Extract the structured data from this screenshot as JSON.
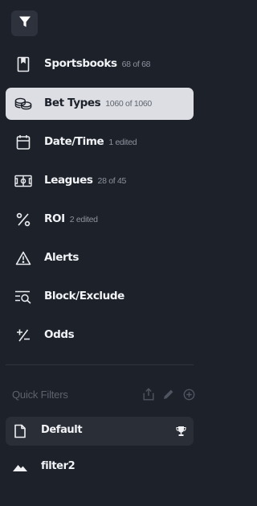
{
  "filter_button": {
    "icon": "filter-icon"
  },
  "nav": {
    "items": [
      {
        "label": "Sportsbooks",
        "count": "68 of 68",
        "icon": "book-icon",
        "selected": false
      },
      {
        "label": "Bet Types",
        "count": "1060 of 1060",
        "icon": "chips-icon",
        "selected": true
      },
      {
        "label": "Date/Time",
        "count": "1 edited",
        "icon": "calendar-icon",
        "selected": false
      },
      {
        "label": "Leagues",
        "count": "28 of 45",
        "icon": "field-icon",
        "selected": false
      },
      {
        "label": "ROI",
        "count": "2 edited",
        "icon": "percent-icon",
        "selected": false
      },
      {
        "label": "Alerts",
        "count": "",
        "icon": "warning-icon",
        "selected": false
      },
      {
        "label": "Block/Exclude",
        "count": "",
        "icon": "search-list-icon",
        "selected": false
      },
      {
        "label": "Odds",
        "count": "",
        "icon": "plus-minus-icon",
        "selected": false
      }
    ]
  },
  "quick_filters": {
    "title": "Quick Filters",
    "actions": [
      "share-icon",
      "edit-icon",
      "add-circle-icon"
    ],
    "items": [
      {
        "label": "Default",
        "icon": "document-icon",
        "active": true,
        "badge_icon": "trophy-icon"
      },
      {
        "label": "filter2",
        "icon": "mountain-icon",
        "active": false
      }
    ]
  },
  "colors": {
    "background": "#1d212a",
    "selected_item": "#dcdee3",
    "active_quick_filter": "#2a2e37",
    "muted_text": "#8d929c"
  }
}
